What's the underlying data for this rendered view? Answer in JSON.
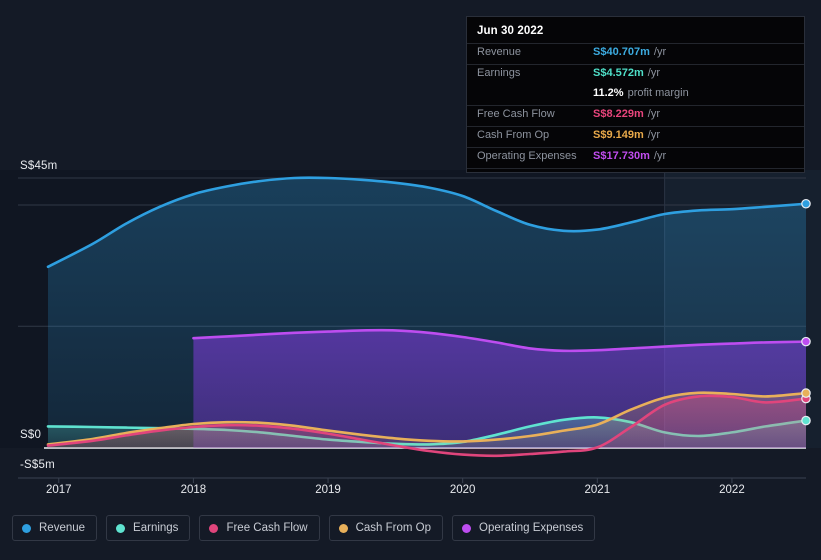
{
  "tooltip": {
    "date": "Jun 30 2022",
    "rows": [
      {
        "label": "Revenue",
        "value": "S$40.707m",
        "unit": "/yr",
        "color": "#3cabe0"
      },
      {
        "label": "Earnings",
        "value": "S$4.572m",
        "unit": "/yr",
        "color": "#4fdfc8"
      },
      {
        "label": "",
        "value": "11.2%",
        "unit": "profit margin",
        "color": "#ffffff"
      },
      {
        "label": "Free Cash Flow",
        "value": "S$8.229m",
        "unit": "/yr",
        "color": "#e8457c"
      },
      {
        "label": "Cash From Op",
        "value": "S$9.149m",
        "unit": "/yr",
        "color": "#e8a94a"
      },
      {
        "label": "Operating Expenses",
        "value": "S$17.730m",
        "unit": "/yr",
        "color": "#c24df0"
      }
    ]
  },
  "legend": [
    {
      "label": "Revenue",
      "color": "#2e9fe0"
    },
    {
      "label": "Earnings",
      "color": "#5fe3d0"
    },
    {
      "label": "Free Cash Flow",
      "color": "#e0457c"
    },
    {
      "label": "Cash From Op",
      "color": "#e8b05a"
    },
    {
      "label": "Operating Expenses",
      "color": "#bd4df0"
    }
  ],
  "chart_data": {
    "type": "area",
    "title": "",
    "xlabel": "",
    "ylabel": "",
    "currency": "S$",
    "unit": "m",
    "grid": true,
    "legend_position": "bottom",
    "ylim": [
      -5,
      45
    ],
    "ytick_labels": [
      "S$45m",
      "S$0",
      "-S$5m"
    ],
    "ytick_values": [
      45,
      0,
      -5
    ],
    "xtick_labels": [
      "2017",
      "2018",
      "2019",
      "2020",
      "2021",
      "2022"
    ],
    "xtick_values": [
      2017,
      2018,
      2019,
      2020,
      2021,
      2022
    ],
    "x_domain": [
      2016.92,
      2022.55
    ],
    "forecast_boundary_x": 2021.5,
    "x": [
      2016.92,
      2017.25,
      2017.5,
      2017.75,
      2018.0,
      2018.25,
      2018.5,
      2018.75,
      2019.0,
      2019.25,
      2019.5,
      2019.75,
      2020.0,
      2020.25,
      2020.5,
      2020.75,
      2021.0,
      2021.25,
      2021.5,
      2021.75,
      2022.0,
      2022.25,
      2022.55
    ],
    "series": [
      {
        "name": "Revenue",
        "color": "#2e9fe0",
        "values": [
          30.2,
          34.0,
          37.4,
          40.2,
          42.3,
          43.6,
          44.5,
          45.0,
          45.0,
          44.7,
          44.2,
          43.4,
          42.0,
          39.5,
          37.2,
          36.2,
          36.4,
          37.6,
          39.0,
          39.6,
          39.8,
          40.2,
          40.707
        ]
      },
      {
        "name": "Earnings",
        "color": "#5fe3d0",
        "values": [
          3.6,
          3.5,
          3.4,
          3.3,
          3.2,
          3.0,
          2.6,
          2.0,
          1.4,
          1.0,
          0.7,
          0.6,
          1.0,
          2.2,
          3.6,
          4.7,
          5.1,
          4.3,
          2.6,
          2.0,
          2.6,
          3.6,
          4.572
        ]
      },
      {
        "name": "Free Cash Flow",
        "color": "#e0457c",
        "values": [
          0.4,
          1.2,
          2.1,
          2.9,
          3.5,
          3.8,
          3.7,
          3.2,
          2.4,
          1.4,
          0.4,
          -0.5,
          -1.1,
          -1.3,
          -1.0,
          -0.6,
          0.1,
          3.5,
          7.2,
          8.6,
          8.5,
          7.6,
          8.229
        ]
      },
      {
        "name": "Cash From Op",
        "color": "#e8b05a",
        "values": [
          0.6,
          1.5,
          2.5,
          3.3,
          4.0,
          4.3,
          4.2,
          3.7,
          2.9,
          2.2,
          1.6,
          1.2,
          1.1,
          1.4,
          2.0,
          2.9,
          3.9,
          6.4,
          8.4,
          9.2,
          9.0,
          8.6,
          9.149
        ]
      },
      {
        "name": "Operating Expenses",
        "color": "#bd4df0",
        "values": [
          null,
          null,
          null,
          null,
          18.3,
          18.6,
          18.9,
          19.2,
          19.4,
          19.6,
          19.6,
          19.2,
          18.5,
          17.6,
          16.6,
          16.2,
          16.3,
          16.6,
          16.9,
          17.2,
          17.4,
          17.6,
          17.73
        ]
      }
    ]
  }
}
